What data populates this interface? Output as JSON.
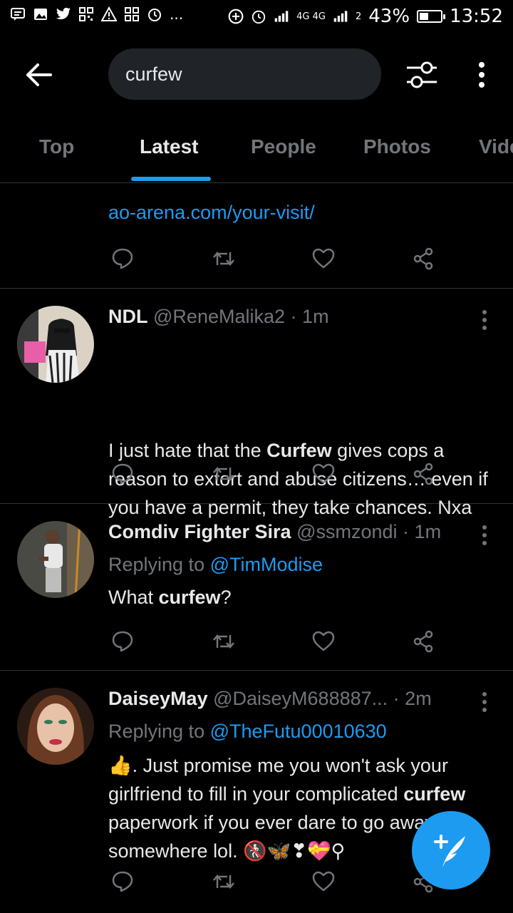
{
  "status_bar": {
    "battery": "43%",
    "time": "13:52",
    "network_label": "4G 4G",
    "sim_slot": "2",
    "battery_level": 0.43,
    "notification_icons": [
      "message-icon",
      "image-icon",
      "twitter-icon",
      "qr-icon",
      "warning-icon",
      "qr-icon",
      "alarm-icon"
    ],
    "overflow": "..."
  },
  "search": {
    "query": "curfew"
  },
  "tabs": [
    {
      "label": "Top"
    },
    {
      "label": "Latest"
    },
    {
      "label": "People"
    },
    {
      "label": "Photos"
    },
    {
      "label": "Vide"
    }
  ],
  "active_tab": "Latest",
  "accent_color": "#1d9bf0",
  "partial_tweet": {
    "link": "ao-arena.com/your-visit/"
  },
  "tweets": [
    {
      "name": "NDL",
      "handle": "@ReneMalika2",
      "separator": "·",
      "time": "1m",
      "text_before": "I just hate that the ",
      "highlight": "Curfew",
      "text_after": " gives cops a reason to extort and abuse citizens… even if you have a permit, they take chances. Nxa"
    },
    {
      "name": "Comdiv Fighter Sira",
      "handle": "@ssmzondi",
      "separator": "·",
      "time": "1m",
      "replying_label": "Replying to ",
      "replying_to": "@TimModise",
      "text_before": "What ",
      "highlight": "curfew",
      "text_after": "?"
    },
    {
      "name": "DaiseyMay",
      "handle": "@DaiseyM688887...",
      "separator": "·",
      "time": "2m",
      "replying_label": "Replying to ",
      "replying_to": "@TheFutu00010630",
      "text_before": "👍. Just promise me you won't ask your girlfriend to fill in your complicated ",
      "highlight": "curfew",
      "text_after": " paperwork if you ever dare to go away somewhere lol. 🚷🦋❣💝⚲"
    }
  ],
  "compose_button": {
    "icon": "compose-tweet-icon"
  }
}
